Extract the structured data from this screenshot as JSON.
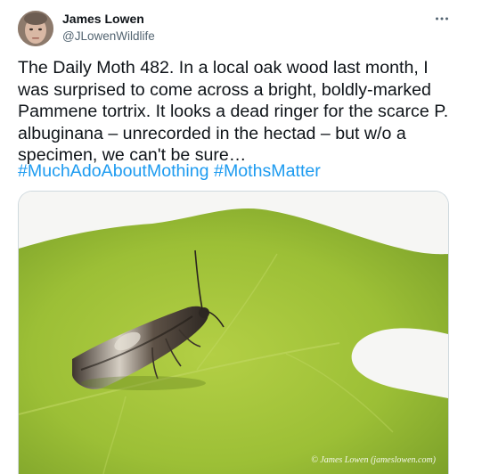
{
  "author": {
    "display_name": "James Lowen",
    "handle": "@JLowenWildlife"
  },
  "more_icon": "more-horizontal-icon",
  "tweet_text": "The Daily Moth 482. In a local oak wood last month, I was surprised to come across a bright, boldly-marked Pammene tortrix. It looks a dead ringer for the scarce P. albuginana – unrecorded in the hectad – but w/o a specimen, we can't be sure…",
  "hashtags": [
    "#MuchAdoAboutMothing",
    "#MothsMatter"
  ],
  "media": {
    "watermark": "© James Lowen (jameslowen.com)"
  },
  "colors": {
    "link": "#1d9bf0",
    "secondary_text": "#536471",
    "leaf_green": "#9cbf36"
  }
}
